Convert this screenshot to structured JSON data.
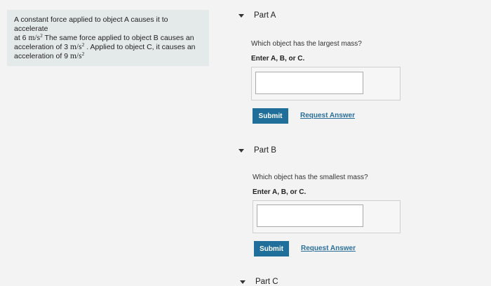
{
  "problem": {
    "line1": "A constant force applied to object A causes it to accelerate",
    "line2_pre": "at 6 ",
    "line2_unit": "m/s",
    "line2_post": " The same force applied to object B causes an",
    "line3_pre": "acceleration of 3 ",
    "line3_unit": "m/s",
    "line3_post": " . Applied to object C, it causes an",
    "line4_pre": "acceleration of 9 ",
    "line4_unit": "m/s",
    "exponent": "2"
  },
  "partA": {
    "title": "Part A",
    "question": "Which object has the largest mass?",
    "instruction": "Enter A, B, or C.",
    "input_value": "",
    "submit_label": "Submit",
    "request_label": "Request Answer"
  },
  "partB": {
    "title": "Part B",
    "question": "Which object has the smallest mass?",
    "instruction": "Enter A, B, or C.",
    "input_value": "",
    "submit_label": "Submit",
    "request_label": "Request Answer"
  },
  "partC": {
    "title": "Part C"
  },
  "colors": {
    "submit_bg": "#1f6f9a",
    "link": "#2a6f9a",
    "problem_bg": "#e4e9ea"
  }
}
